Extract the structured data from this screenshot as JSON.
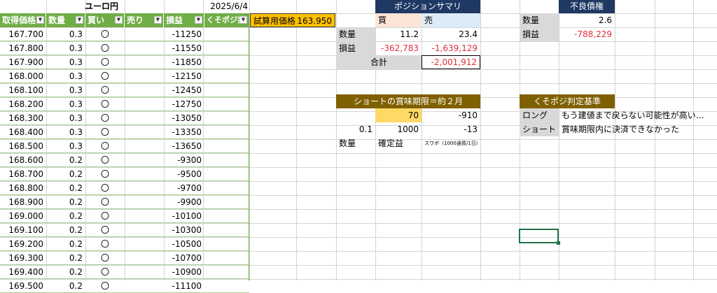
{
  "sheet": {
    "title": "ユーロ円",
    "date": "2025/6/4"
  },
  "table": {
    "headers": [
      "取得価格",
      "数量",
      "買い",
      "売り",
      "損益",
      "くそポジ判"
    ],
    "rows": [
      [
        "167.700",
        "0.3",
        "〇",
        "",
        "-11250"
      ],
      [
        "167.800",
        "0.3",
        "〇",
        "",
        "-11550"
      ],
      [
        "167.900",
        "0.3",
        "〇",
        "",
        "-11850"
      ],
      [
        "168.000",
        "0.3",
        "〇",
        "",
        "-12150"
      ],
      [
        "168.100",
        "0.3",
        "〇",
        "",
        "-12450"
      ],
      [
        "168.200",
        "0.3",
        "〇",
        "",
        "-12750"
      ],
      [
        "168.300",
        "0.3",
        "〇",
        "",
        "-13050"
      ],
      [
        "168.400",
        "0.3",
        "〇",
        "",
        "-13350"
      ],
      [
        "168.500",
        "0.3",
        "〇",
        "",
        "-13650"
      ],
      [
        "168.600",
        "0.2",
        "〇",
        "",
        "-9300"
      ],
      [
        "168.700",
        "0.2",
        "〇",
        "",
        "-9500"
      ],
      [
        "168.800",
        "0.2",
        "〇",
        "",
        "-9700"
      ],
      [
        "168.900",
        "0.2",
        "〇",
        "",
        "-9900"
      ],
      [
        "169.000",
        "0.2",
        "〇",
        "",
        "-10100"
      ],
      [
        "169.100",
        "0.2",
        "〇",
        "",
        "-10300"
      ],
      [
        "169.200",
        "0.2",
        "〇",
        "",
        "-10500"
      ],
      [
        "169.300",
        "0.2",
        "〇",
        "",
        "-10700"
      ],
      [
        "169.400",
        "0.2",
        "〇",
        "",
        "-10900"
      ],
      [
        "169.500",
        "0.2",
        "〇",
        "",
        "-11100"
      ]
    ]
  },
  "trial_price": {
    "label": "試算用価格",
    "value": "163.950"
  },
  "summary": {
    "title": "ポジションサマリ",
    "buy_label": "買",
    "sell_label": "売",
    "qty_label": "数量",
    "qty_buy": "11.2",
    "qty_sell": "23.4",
    "pl_label": "損益",
    "pl_buy": "-362,783",
    "pl_sell": "-1,639,129",
    "total_label": "合計",
    "total_value": "-2,001,912"
  },
  "bad_debt": {
    "title": "不良債権",
    "qty_label": "数量",
    "qty_value": "2.6",
    "pl_label": "損益",
    "pl_value": "-788,229"
  },
  "short_expiry": {
    "title": "ショートの賞味期限＝約２月",
    "r1_b": "70",
    "r1_c": "-910",
    "r2_a": "0.1",
    "r2_b": "1000",
    "r2_c": "-13",
    "r3_a": "数量",
    "r3_b": "確定益",
    "r3_c": "スワポ（1000通貨/1日）"
  },
  "criteria": {
    "title": "くそポジ判定基準",
    "long_label": "ロング",
    "long_text": "もう建値まで戻らない可能性が高い…",
    "short_label": "ショート",
    "short_text": "賞味期限内に決済できなかった"
  },
  "colors": {
    "table_header": "#70ad47",
    "navy": "#1f3864",
    "brown": "#7f6000",
    "gold": "#ffc000",
    "negative": "#e0303a"
  }
}
